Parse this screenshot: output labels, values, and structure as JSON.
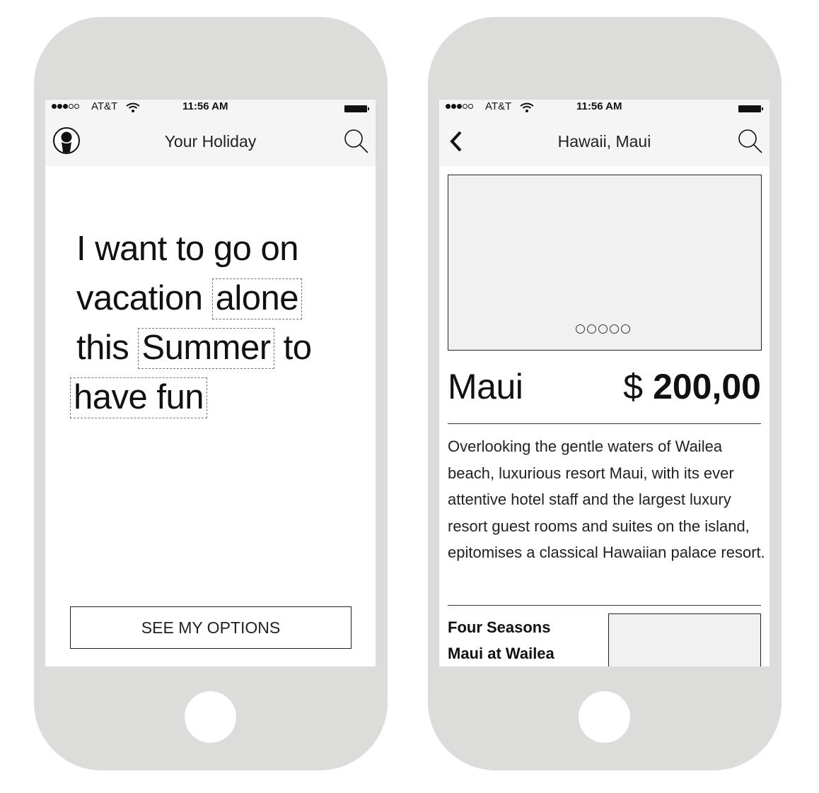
{
  "status_bar": {
    "carrier": "AT&T",
    "time": "11:56 AM",
    "signal_bars_full": 3,
    "signal_bars_empty": 2
  },
  "left_screen": {
    "nav": {
      "title": "Your Holiday",
      "left_icon": "user-avatar-icon",
      "right_icon": "search-icon"
    },
    "sentence": {
      "part1": "I want to go on",
      "part2": "vacation",
      "token_companion": "alone",
      "part3": "this",
      "token_season": "Summer",
      "part4": "to",
      "token_purpose": "have fun"
    },
    "options_button": "SEE MY OPTIONS"
  },
  "right_screen": {
    "nav": {
      "title": "Hawaii, Maui",
      "left_icon": "back-chevron-icon",
      "right_icon": "search-icon"
    },
    "gallery": {
      "page_count": 5
    },
    "place_name": "Maui",
    "price_currency": "$",
    "price_amount": "200,00",
    "description": "Overlooking the gentle waters of Wailea beach, luxurious resort Maui, with its ever attentive hotel staff and the largest luxury resort guest rooms and suites on the island, epitomises a classical Hawaiian palace resort.",
    "hotel": {
      "name_line1": "Four Seasons",
      "name_line2": "Maui at Wailea"
    }
  },
  "colors": {
    "device_body": "#dcdcdb",
    "bar_background": "#f5f5f5",
    "placeholder": "#f1f1f1"
  }
}
